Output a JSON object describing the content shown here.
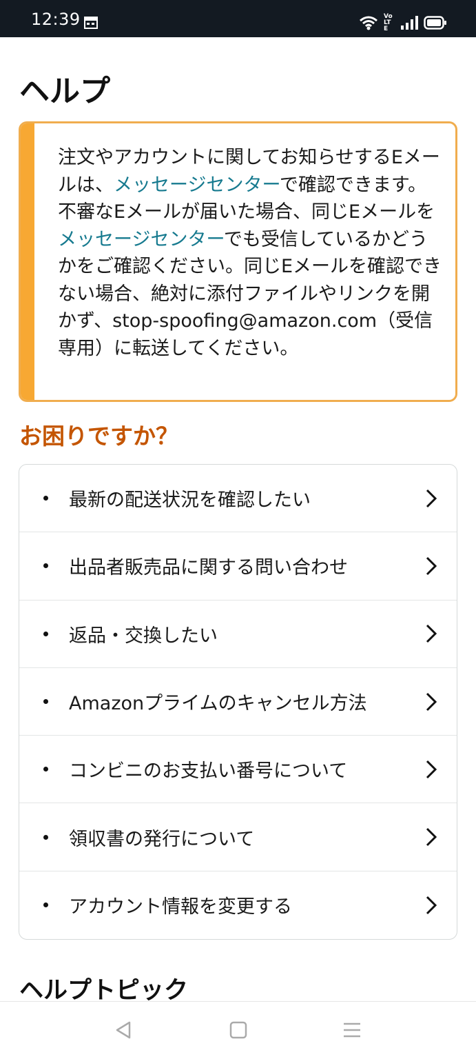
{
  "status_bar": {
    "time": "12:39",
    "volte_text": "Vo LTE",
    "icons": [
      "calendar-icon",
      "wifi-icon",
      "volte-icon",
      "signal-icon",
      "battery-icon"
    ]
  },
  "page": {
    "title": "ヘルプ"
  },
  "alert": {
    "accent_color": "#f7a833",
    "link_color": "#167a8f",
    "seg1": "注文やアカウントに関してお知らせするEメールは、",
    "link1": "メッセージセンター",
    "seg2": "で確認できます。不審なEメールが届いた場合、同じEメールを",
    "link2": "メッセージセンター",
    "seg3": "でも受信しているかどうかをご確認ください。同じEメールを確認できない場合、絶対に添付ファイルやリンクを開かず、stop-spoofing@amazon.com（受信専用）に転送してください。"
  },
  "help": {
    "heading": "お困りですか？",
    "heading_color": "#c45500",
    "items": [
      {
        "label": "最新の配送状況を確認したい"
      },
      {
        "label": "出品者販売品に関する問い合わせ"
      },
      {
        "label": "返品・交換したい"
      },
      {
        "label": "Amazonプライムのキャンセル方法"
      },
      {
        "label": "コンビニのお支払い番号について"
      },
      {
        "label": "領収書の発行について"
      },
      {
        "label": "アカウント情報を変更する"
      }
    ]
  },
  "topics": {
    "heading": "ヘルプトピック"
  },
  "nav_bar": {
    "buttons": [
      "back-triangle-icon",
      "home-square-icon",
      "menu-lines-icon"
    ]
  }
}
